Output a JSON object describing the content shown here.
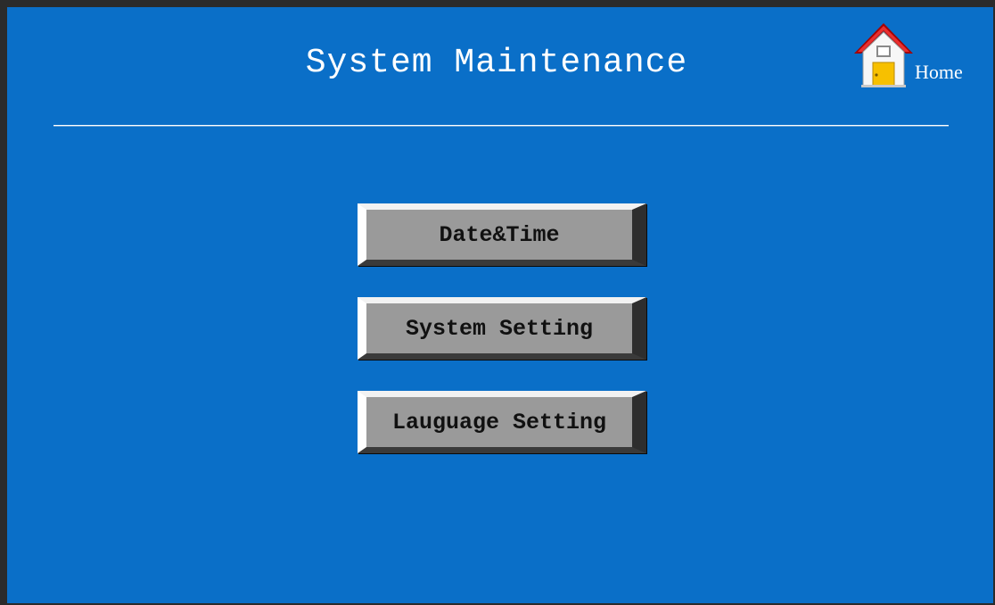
{
  "screen": {
    "title": "System Maintenance",
    "background_color": "#0a6fc8"
  },
  "home": {
    "label": "Home",
    "icon": "home-icon"
  },
  "menu": {
    "items": [
      {
        "label": "Date&Time"
      },
      {
        "label": "System Setting"
      },
      {
        "label": "Lauguage Setting"
      }
    ]
  }
}
